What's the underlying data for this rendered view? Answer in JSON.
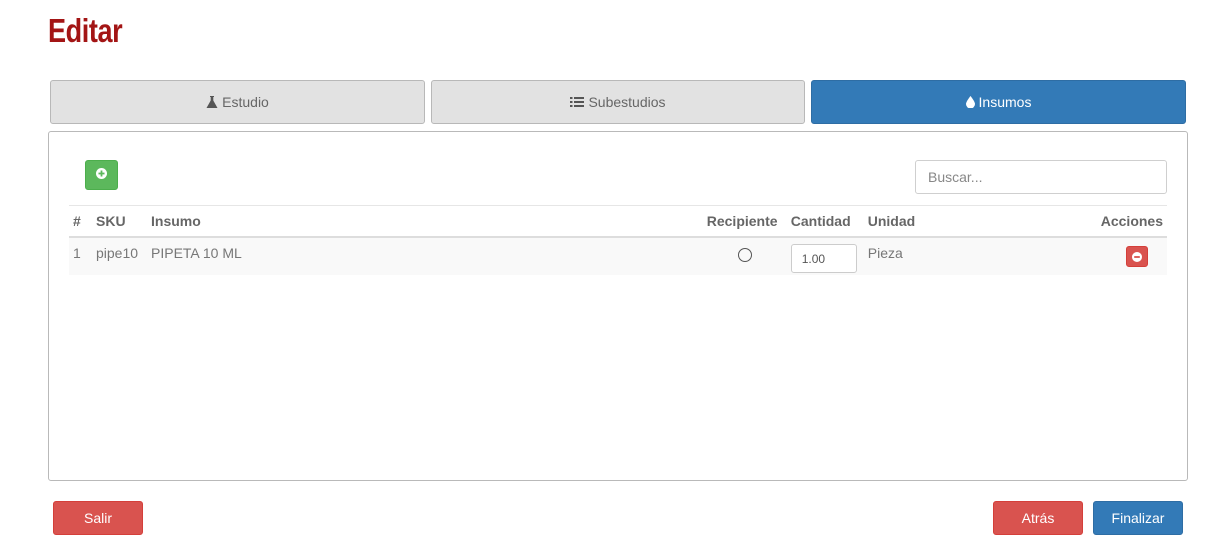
{
  "page": {
    "title": "Editar"
  },
  "tabs": [
    {
      "label": "Estudio",
      "icon": "flask-icon"
    },
    {
      "label": "Subestudios",
      "icon": "list-icon"
    },
    {
      "label": "Insumos",
      "icon": "tint-icon",
      "active": true
    }
  ],
  "panel": {
    "search_placeholder": "Buscar...",
    "table": {
      "headers": [
        "#",
        "SKU",
        "Insumo",
        "Recipiente",
        "Cantidad",
        "Unidad",
        "Acciones"
      ],
      "rows": [
        {
          "num": "1",
          "sku": "pipe10",
          "insumo": "PIPETA 10 ML",
          "recipiente": false,
          "cantidad": "1.00",
          "unidad": "Pieza"
        }
      ]
    }
  },
  "footer": {
    "exit_label": "Salir",
    "back_label": "Atrás",
    "finish_label": "Finalizar"
  },
  "colors": {
    "title": "#a31515",
    "primary": "#337ab7",
    "success": "#5cb85c",
    "danger": "#d9534f"
  }
}
